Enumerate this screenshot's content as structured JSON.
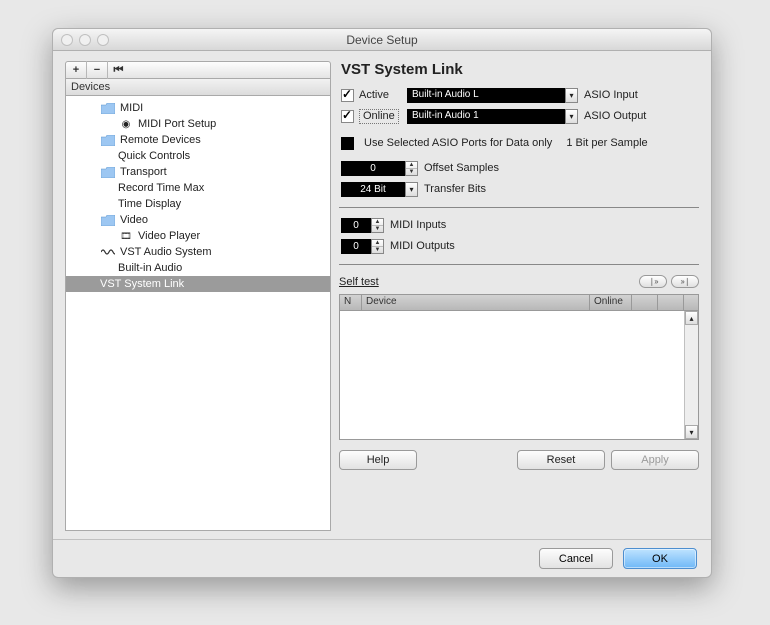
{
  "window": {
    "title": "Device Setup"
  },
  "sidebar": {
    "header": "Devices",
    "toolbar": {
      "add": "+",
      "remove": "−",
      "reset": "⏮"
    },
    "items": [
      {
        "label": "MIDI",
        "icon": "folder"
      },
      {
        "label": "MIDI Port Setup",
        "icon": "gear",
        "indent": 2
      },
      {
        "label": "Remote Devices",
        "icon": "folder"
      },
      {
        "label": "Quick Controls",
        "indent": 2
      },
      {
        "label": "Transport",
        "icon": "folder"
      },
      {
        "label": "Record Time Max",
        "indent": 2
      },
      {
        "label": "Time Display",
        "indent": 2
      },
      {
        "label": "Video",
        "icon": "folder"
      },
      {
        "label": "Video Player",
        "icon": "vp",
        "indent": 2
      },
      {
        "label": "VST Audio System",
        "icon": "wave"
      },
      {
        "label": "Built-in Audio",
        "indent": 2
      },
      {
        "label": "VST System Link",
        "selected": true
      }
    ]
  },
  "panel": {
    "title": "VST System Link",
    "active": {
      "label": "Active",
      "checked": true
    },
    "online": {
      "label": "Online",
      "checked": true
    },
    "asio_input": {
      "value": "Built-in Audio L",
      "label": "ASIO Input"
    },
    "asio_output": {
      "value": "Built-in Audio 1",
      "label": "ASIO Output"
    },
    "dataonly": {
      "checked": false,
      "label": "Use Selected ASIO Ports for Data only",
      "extra": "1 Bit per Sample"
    },
    "offset": {
      "value": "0",
      "label": "Offset Samples"
    },
    "transfer": {
      "value": "24 Bit",
      "label": "Transfer Bits"
    },
    "midi_in": {
      "value": "0",
      "label": "MIDI Inputs"
    },
    "midi_out": {
      "value": "0",
      "label": "MIDI Outputs"
    },
    "selftest": {
      "label": "Self test"
    },
    "table": {
      "cols": [
        "N",
        "Device",
        "Online"
      ]
    },
    "buttons": {
      "help": "Help",
      "reset": "Reset",
      "apply": "Apply"
    }
  },
  "footer": {
    "cancel": "Cancel",
    "ok": "OK"
  }
}
